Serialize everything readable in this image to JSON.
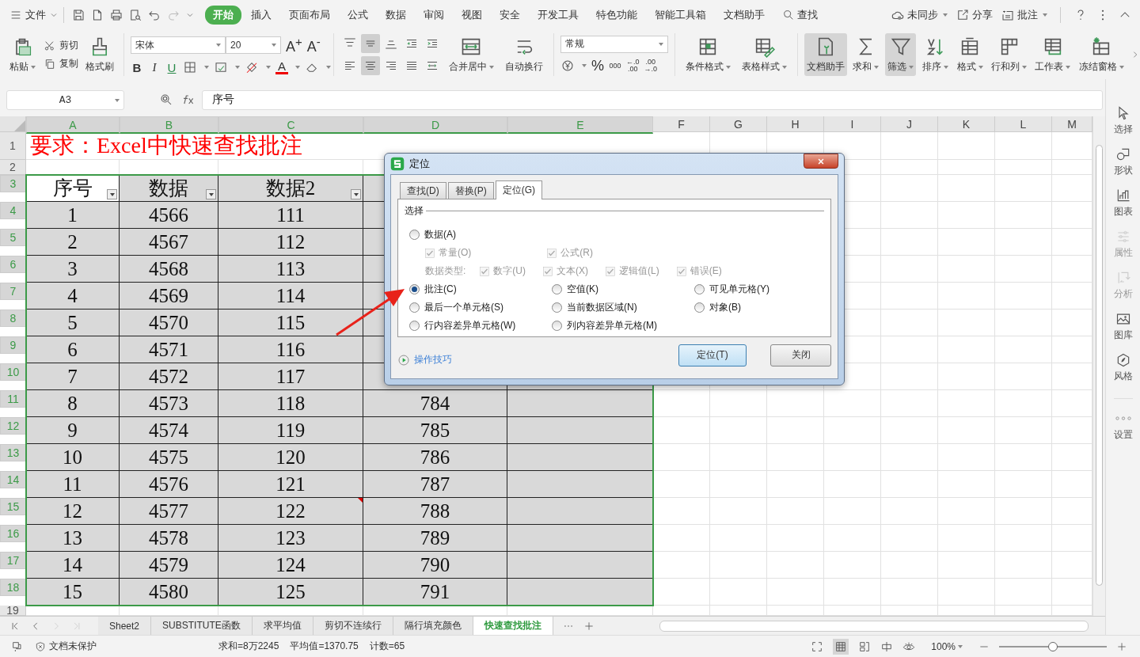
{
  "top_bar": {
    "file_menu": "文件",
    "tabs": [
      {
        "label": "开始",
        "selected": true
      },
      {
        "label": "插入",
        "selected": false
      },
      {
        "label": "页面布局",
        "selected": false
      },
      {
        "label": "公式",
        "selected": false
      },
      {
        "label": "数据",
        "selected": false
      },
      {
        "label": "审阅",
        "selected": false
      },
      {
        "label": "视图",
        "selected": false
      },
      {
        "label": "安全",
        "selected": false
      },
      {
        "label": "开发工具",
        "selected": false
      },
      {
        "label": "特色功能",
        "selected": false
      },
      {
        "label": "智能工具箱",
        "selected": false
      },
      {
        "label": "文档助手",
        "selected": false
      }
    ],
    "search": "查找",
    "sync": "未同步",
    "share": "分享",
    "review": "批注"
  },
  "ribbon": {
    "paste": "粘贴",
    "cut": "剪切",
    "copy": "复制",
    "format_painter": "格式刷",
    "font_name": "宋体",
    "font_size": "20",
    "grow_font": "A$^{+}$",
    "shrink_font": "A$^{-}$",
    "bold": "B",
    "italic": "I",
    "underline": "U",
    "font_color": "A",
    "align_buttons": [
      {
        "pressed": false
      },
      {
        "pressed": true
      },
      {
        "pressed": false
      },
      {
        "pressed": false
      },
      {
        "pressed": false
      },
      {
        "pressed": false
      },
      {
        "pressed": true
      },
      {
        "pressed": false
      },
      {
        "pressed": false
      },
      {
        "pressed": false
      }
    ],
    "merge": "合并居中",
    "wrap": "自动换行",
    "number_format": "常规",
    "percent": "%",
    "thousands": "000",
    "decimal_buttons": [
      {
        "top": "←.0",
        "bottom": ".00"
      },
      {
        "top": ".00",
        "bottom": "→.0"
      }
    ],
    "style_buttons": [
      {
        "label": "条件格式",
        "pressed": false,
        "dropdown": true
      },
      {
        "label": "表格样式",
        "pressed": false,
        "dropdown": true
      }
    ],
    "tool_buttons": [
      {
        "label": "文档助手",
        "pressed": true,
        "dropdown": false
      },
      {
        "label": "求和",
        "pressed": false,
        "dropdown": true
      },
      {
        "label": "筛选",
        "pressed": true,
        "dropdown": true
      },
      {
        "label": "排序",
        "pressed": false,
        "dropdown": true
      },
      {
        "label": "格式",
        "pressed": false,
        "dropdown": true
      },
      {
        "label": "行和列",
        "pressed": false,
        "dropdown": true
      },
      {
        "label": "工作表",
        "pressed": false,
        "dropdown": true
      },
      {
        "label": "冻结窗格",
        "pressed": false,
        "dropdown": true
      }
    ]
  },
  "formula_bar": {
    "name_box": "A3",
    "formula": "序号"
  },
  "sheet": {
    "columns": [
      {
        "label": "A",
        "selected": true
      },
      {
        "label": "B",
        "selected": true
      },
      {
        "label": "C",
        "selected": true
      },
      {
        "label": "D",
        "selected": true
      },
      {
        "label": "E",
        "selected": true
      },
      {
        "label": "F",
        "selected": false
      },
      {
        "label": "G",
        "selected": false
      },
      {
        "label": "H",
        "selected": false
      },
      {
        "label": "I",
        "selected": false
      },
      {
        "label": "J",
        "selected": false
      },
      {
        "label": "K",
        "selected": false
      },
      {
        "label": "L",
        "selected": false
      },
      {
        "label": "M",
        "selected": false
      }
    ],
    "rows": [
      {
        "label": "1",
        "selected": false
      },
      {
        "label": "2",
        "selected": false
      },
      {
        "label": "3",
        "selected": true
      },
      {
        "label": "4",
        "selected": true
      },
      {
        "label": "5",
        "selected": true
      },
      {
        "label": "6",
        "selected": true
      },
      {
        "label": "7",
        "selected": true
      },
      {
        "label": "8",
        "selected": true
      },
      {
        "label": "9",
        "selected": true
      },
      {
        "label": "10",
        "selected": true
      },
      {
        "label": "11",
        "selected": true
      },
      {
        "label": "12",
        "selected": true
      },
      {
        "label": "13",
        "selected": true
      },
      {
        "label": "14",
        "selected": true
      },
      {
        "label": "15",
        "selected": true
      },
      {
        "label": "16",
        "selected": true
      },
      {
        "label": "17",
        "selected": true
      },
      {
        "label": "18",
        "selected": true
      },
      {
        "label": "19",
        "selected": false
      }
    ],
    "title": "要求：Excel中快速查找批注",
    "table": {
      "header": [
        {
          "label": "序号",
          "active": true
        },
        {
          "label": "数据",
          "active": false
        },
        {
          "label": "数据2",
          "active": false
        }
      ],
      "rows": [
        {
          "cells": [
            "1",
            "4566",
            "111"
          ],
          "comment": false
        },
        {
          "cells": [
            "2",
            "4567",
            "112"
          ],
          "comment": false
        },
        {
          "cells": [
            "3",
            "4568",
            "113"
          ],
          "comment": false
        },
        {
          "cells": [
            "4",
            "4569",
            "114"
          ],
          "comment": false
        },
        {
          "cells": [
            "5",
            "4570",
            "115"
          ],
          "comment": false
        },
        {
          "cells": [
            "6",
            "4571",
            "116"
          ],
          "comment": false
        },
        {
          "cells": [
            "7",
            "4572",
            "117"
          ],
          "comment": false
        },
        {
          "cells": [
            "8",
            "4573",
            "118",
            "784"
          ],
          "comment": false
        },
        {
          "cells": [
            "9",
            "4574",
            "119",
            "785"
          ],
          "comment": false
        },
        {
          "cells": [
            "10",
            "4575",
            "120",
            "786"
          ],
          "comment": false
        },
        {
          "cells": [
            "11",
            "4576",
            "121",
            "787"
          ],
          "comment": false
        },
        {
          "cells": [
            "12",
            "4577",
            "122",
            "788"
          ],
          "comment": true
        },
        {
          "cells": [
            "13",
            "4578",
            "123",
            "789"
          ],
          "comment": false
        },
        {
          "cells": [
            "14",
            "4579",
            "124",
            "790"
          ],
          "comment": false
        },
        {
          "cells": [
            "15",
            "4580",
            "125",
            "791"
          ],
          "comment": false
        }
      ]
    }
  },
  "dialog": {
    "title": "定位",
    "tabs": [
      {
        "label": "查找(D)",
        "selected": false
      },
      {
        "label": "替换(P)",
        "selected": false
      },
      {
        "label": "定位(G)",
        "selected": true
      }
    ],
    "group": "选择",
    "data_option": {
      "label": "数据(A)",
      "selected": false
    },
    "data_checks": [
      {
        "label": "常量(O)",
        "checked": true,
        "disabled": true
      },
      {
        "label": "公式(R)",
        "checked": true,
        "disabled": true
      }
    ],
    "data_type_label": "数据类型:",
    "type_checks": [
      {
        "label": "数字(U)",
        "checked": true,
        "disabled": true
      },
      {
        "label": "文本(X)",
        "checked": true,
        "disabled": true
      },
      {
        "label": "逻辑值(L)",
        "checked": true,
        "disabled": true
      },
      {
        "label": "错误(E)",
        "checked": true,
        "disabled": true
      }
    ],
    "options": [
      {
        "label": "批注(C)",
        "selected": true
      },
      {
        "label": "空值(K)",
        "selected": false
      },
      {
        "label": "可见单元格(Y)",
        "selected": false
      },
      {
        "label": "最后一个单元格(S)",
        "selected": false
      },
      {
        "label": "当前数据区域(N)",
        "selected": false
      },
      {
        "label": "对象(B)",
        "selected": false
      },
      {
        "label": "行内容差异单元格(W)",
        "selected": false
      },
      {
        "label": "列内容差异单元格(M)",
        "selected": false
      }
    ],
    "tips": "操作技巧",
    "buttons": [
      {
        "label": "定位(T)",
        "default": true
      },
      {
        "label": "关闭",
        "default": false
      }
    ]
  },
  "side_panel": {
    "items": [
      {
        "label": "选择",
        "disabled": false
      },
      {
        "label": "形状",
        "disabled": false
      },
      {
        "label": "图表",
        "disabled": false
      },
      {
        "label": "属性",
        "disabled": true
      },
      {
        "label": "分析",
        "disabled": true
      },
      {
        "label": "图库",
        "disabled": false
      },
      {
        "label": "风格",
        "disabled": false
      },
      {
        "label": "设置",
        "disabled": false
      }
    ]
  },
  "sheet_tabs": [
    {
      "label": "Sheet2",
      "selected": false
    },
    {
      "label": "SUBSTITUTE函数",
      "selected": false
    },
    {
      "label": "求平均值",
      "selected": false
    },
    {
      "label": "剪切不连续行",
      "selected": false
    },
    {
      "label": "隔行填充颜色",
      "selected": false
    },
    {
      "label": "快速查找批注",
      "selected": true
    }
  ],
  "status_bar": {
    "protection": "文档未保护",
    "sum": "求和=8万2245",
    "average": "平均值=1370.75",
    "count": "计数=65",
    "zoom": "100%",
    "zoom_slider": {
      "level": 0.5
    }
  }
}
